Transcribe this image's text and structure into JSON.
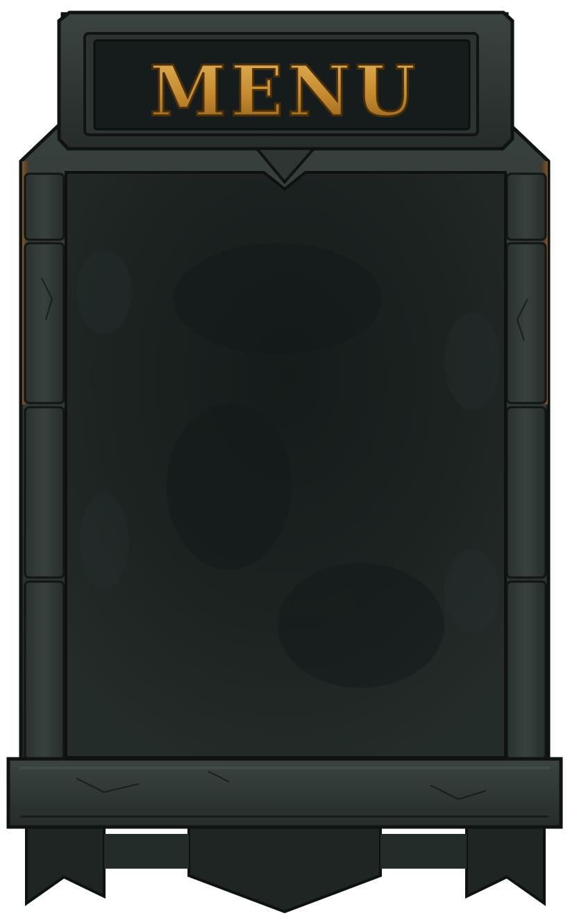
{
  "panel": {
    "title": "MENU"
  },
  "colors": {
    "stone_dark": "#1f2624",
    "stone_mid": "#2d3532",
    "stone_light": "#3d4743",
    "stone_edge": "#111614",
    "panel_inner": "#1b2220",
    "title_plate": "#161c1b",
    "gold": "#c48a2e",
    "gold_light": "#e0aa4d",
    "gold_dark": "#6a4410",
    "rust": "#8a5420"
  },
  "icons": {
    "banner": "stone-banner-frame",
    "tabs": "pennant-tab-icon"
  }
}
